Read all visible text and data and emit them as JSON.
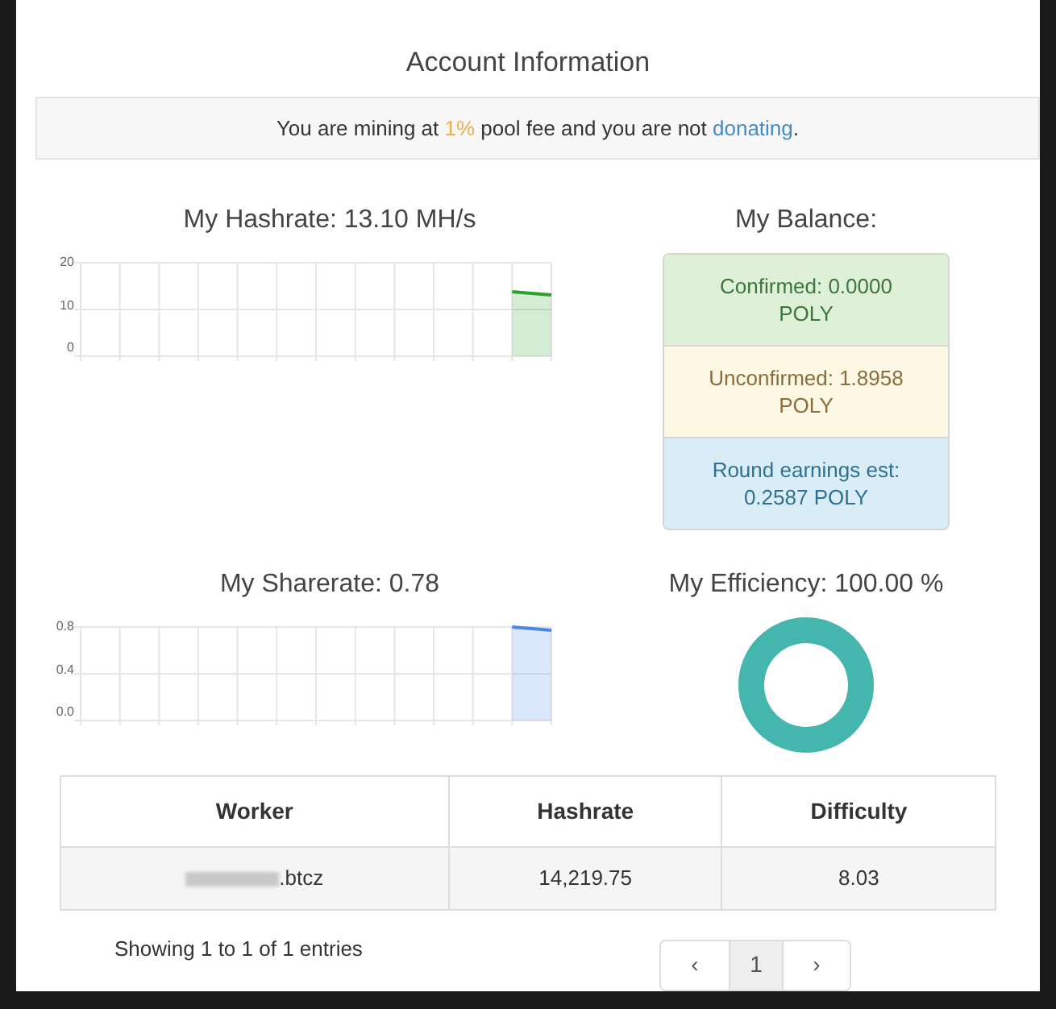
{
  "panel": {
    "title": "Account Information"
  },
  "notice": {
    "text": "You are mining at ",
    "fee": "1%",
    "middle": " pool fee and you are not ",
    "link": "donating",
    "end": "."
  },
  "hashrate": {
    "title": "My Hashrate: 13.10 MH/s",
    "yticks": [
      "20",
      "10",
      "0"
    ]
  },
  "balance": {
    "title": "My Balance:",
    "items": [
      {
        "kind": "success",
        "text": "Confirmed: 0.0000 POLY"
      },
      {
        "kind": "warning",
        "text": "Unconfirmed: 1.8958 POLY"
      },
      {
        "kind": "info",
        "text": "Round earnings est: 0.2587 POLY"
      }
    ]
  },
  "sharerate": {
    "title": "My Sharerate: 0.78",
    "yticks": [
      "0.8",
      "0.4",
      "0.0"
    ]
  },
  "efficiency": {
    "title": "My Efficiency: 100.00 %",
    "level": 1
  },
  "table": {
    "columns": [
      "Worker",
      "Hashrate",
      "Difficulty"
    ],
    "rows": [
      {
        "cells": [
          ".btcz",
          "14,219.75",
          "8.03"
        ],
        "blurred_prefix": true
      }
    ]
  },
  "info": "Showing 1 to 1 of 1 entries",
  "pagination": [
    {
      "label": "‹",
      "kind": "prev",
      "selected": false
    },
    {
      "label": "1",
      "kind": "page",
      "selected": true
    },
    {
      "label": "›",
      "kind": "next",
      "selected": false
    }
  ]
}
